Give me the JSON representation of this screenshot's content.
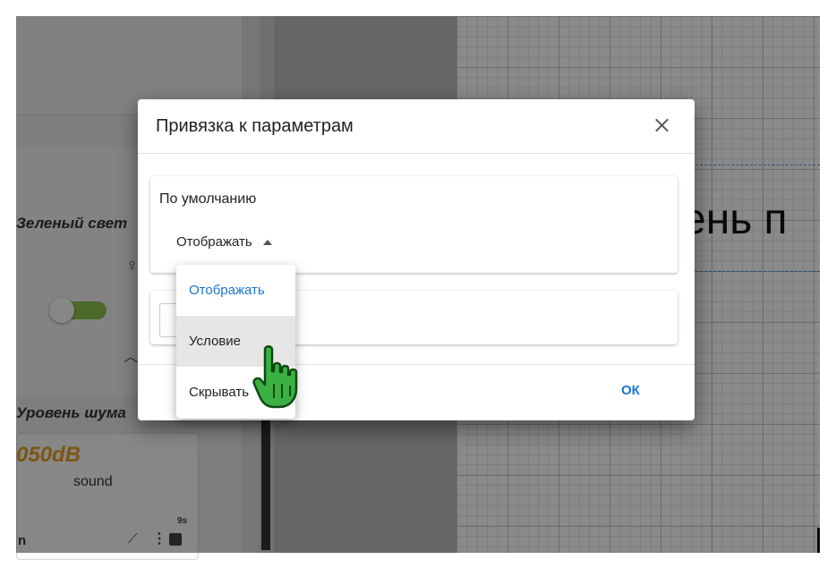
{
  "background": {
    "widget_green": {
      "label": "Зеленый свет"
    },
    "widget_noise": {
      "label": "Уровень шума",
      "value": "050dB",
      "unit": "sound",
      "corner_label": "n",
      "badge": "9s"
    },
    "canvas_text": "ень п"
  },
  "dialog": {
    "title": "Привязка к параметрам",
    "section_title": "По умолчанию",
    "select_value": "Отображать",
    "ok_label": "ОК"
  },
  "menu": {
    "items": [
      {
        "label": "Отображать",
        "state": "selected"
      },
      {
        "label": "Условие",
        "state": "hover"
      },
      {
        "label": "Скрывать",
        "state": "normal"
      }
    ]
  },
  "colors": {
    "accent": "#1976d2",
    "toggle_on": "#8bc34a",
    "value_orange": "#e6a220",
    "cursor_green": "#3cb043"
  },
  "icons": [
    "close-icon",
    "caret-up-icon",
    "bulb-icon",
    "chevron-up-icon",
    "chart-icon",
    "more-vert-icon",
    "image-icon",
    "hand-cursor-icon"
  ]
}
